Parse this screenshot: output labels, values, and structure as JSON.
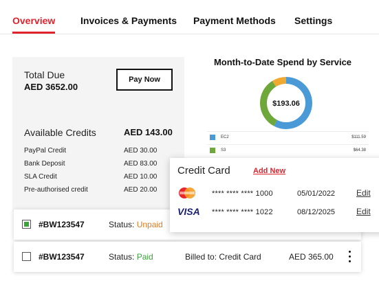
{
  "tabs": [
    {
      "label": "Overview",
      "active": true
    },
    {
      "label": "Invoices & Payments",
      "active": false
    },
    {
      "label": "Payment Methods",
      "active": false
    },
    {
      "label": "Settings",
      "active": false
    }
  ],
  "summary": {
    "total_due_label": "Total Due",
    "total_due_value": "AED 3652.00",
    "pay_now_label": "Pay Now",
    "available_credits_label": "Available Credits",
    "available_credits_value": "AED 143.00",
    "credits": [
      {
        "label": "PayPal Credit",
        "amount": "AED 30.00"
      },
      {
        "label": "Bank Deposit",
        "amount": "AED 83.00"
      },
      {
        "label": "SLA Credit",
        "amount": "AED 10.00"
      },
      {
        "label": "Pre-authorised credit",
        "amount": "AED 20.00"
      }
    ]
  },
  "spend": {
    "title": "Month-to-Date Spend by Service",
    "center_label": "$193.06",
    "legend": [
      {
        "name": "EC2",
        "value": "$111.59",
        "color": "#4a9ad8"
      },
      {
        "name": "S3",
        "value": "$64.38",
        "color": "#6fa83a"
      }
    ]
  },
  "chart_data": {
    "type": "pie",
    "style": "donut",
    "title": "Month-to-Date Spend by Service",
    "center_label": "$193.06",
    "slices": [
      {
        "name": "EC2",
        "value": 111.59,
        "color": "#4a9ad8"
      },
      {
        "name": "S3",
        "value": 64.38,
        "color": "#6fa83a"
      },
      {
        "name": "",
        "value": 17.09,
        "color": "#f0a830"
      }
    ]
  },
  "credit_card": {
    "title": "Credit Card",
    "add_new_label": "Add New",
    "cards": [
      {
        "brand": "mastercard",
        "number": "**** **** **** 1000",
        "expiry": "05/01/2022",
        "edit_label": "Edit"
      },
      {
        "brand": "visa",
        "brand_text": "VISA",
        "number": "**** **** **** 1022",
        "expiry": "08/12/2025",
        "edit_label": "Edit"
      }
    ]
  },
  "invoices": [
    {
      "id": "#BW123547",
      "status_label": "Status:",
      "status": "Unpaid",
      "checked": true,
      "billed_to": "",
      "amount": ""
    },
    {
      "id": "#BW123547",
      "status_label": "Status:",
      "status": "Paid",
      "checked": false,
      "billed_to": "Billed to: Credit Card",
      "amount": "AED 365.00"
    }
  ],
  "colors": {
    "accent": "#e0222c",
    "unpaid": "#e07a22",
    "paid": "#3aa33a",
    "donut_ec2": "#4a9ad8",
    "donut_s3": "#6fa83a",
    "donut_other": "#f0a830"
  }
}
